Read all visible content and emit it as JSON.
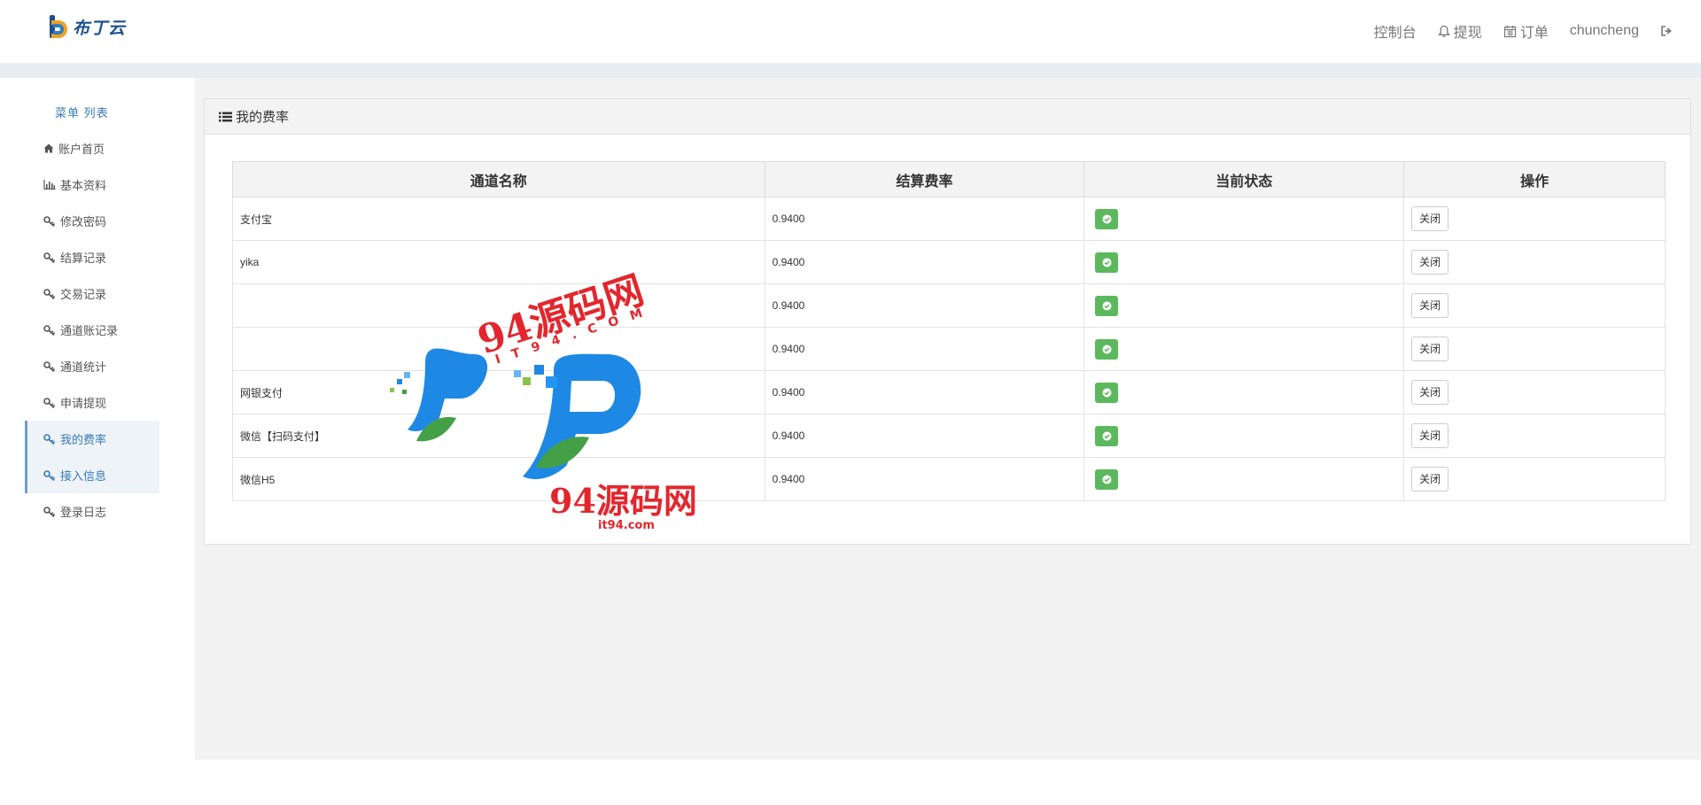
{
  "brand": {
    "logo_text": "布丁云"
  },
  "topnav": {
    "console": "控制台",
    "withdraw": "提现",
    "orders": "订单",
    "username": "chuncheng"
  },
  "sidebar": {
    "title": "菜单 列表",
    "items": [
      {
        "label": "账户首页",
        "icon": "home-icon"
      },
      {
        "label": "基本资料",
        "icon": "bar-chart-icon"
      },
      {
        "label": "修改密码",
        "icon": "key-icon"
      },
      {
        "label": "结算记录",
        "icon": "key-icon"
      },
      {
        "label": "交易记录",
        "icon": "key-icon"
      },
      {
        "label": "通道账记录",
        "icon": "key-icon"
      },
      {
        "label": "通道统计",
        "icon": "key-icon"
      },
      {
        "label": "申请提现",
        "icon": "key-icon"
      },
      {
        "label": "我的费率",
        "icon": "key-icon",
        "active": true
      },
      {
        "label": "接入信息",
        "icon": "key-icon",
        "active": true
      },
      {
        "label": "登录日志",
        "icon": "key-icon"
      }
    ]
  },
  "panel": {
    "title": "我的费率",
    "table": {
      "headers": [
        "通道名称",
        "结算费率",
        "当前状态",
        "操作"
      ],
      "rows": [
        {
          "name": "支付宝",
          "rate": "0.9400",
          "action": "关闭"
        },
        {
          "name": "yika",
          "rate": "0.9400",
          "action": "关闭"
        },
        {
          "name": "",
          "rate": "0.9400",
          "action": "关闭"
        },
        {
          "name": "",
          "rate": "0.9400",
          "action": "关闭"
        },
        {
          "name": "网银支付",
          "rate": "0.9400",
          "action": "关闭"
        },
        {
          "name": "微信【扫码支付】",
          "rate": "0.9400",
          "action": "关闭"
        },
        {
          "name": "微信H5",
          "rate": "0.9400",
          "action": "关闭"
        }
      ]
    }
  },
  "watermark": {
    "line1": "94源码网",
    "line2": "IT94.COM",
    "line3": "94源码网",
    "line4": "it94.com"
  },
  "colors": {
    "accent": "#3a7ab5",
    "status_green": "#5cb85c",
    "watermark_red": "#e3262d",
    "watermark_blue": "#1e88e5"
  }
}
